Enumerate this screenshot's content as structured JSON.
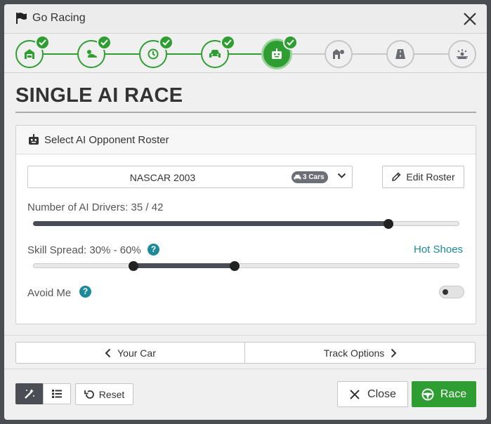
{
  "window": {
    "title": "Go Racing",
    "close_icon": "close-icon"
  },
  "steps": [
    {
      "name": "garage",
      "icon": "garage-icon",
      "state": "done"
    },
    {
      "name": "weather",
      "icon": "weather-icon",
      "state": "done"
    },
    {
      "name": "time",
      "icon": "clock-icon",
      "state": "done"
    },
    {
      "name": "car",
      "icon": "car-icon",
      "state": "done"
    },
    {
      "name": "ai-opponents",
      "icon": "robot-icon",
      "state": "active"
    },
    {
      "name": "pit-crew",
      "icon": "pit-icon",
      "state": "todo"
    },
    {
      "name": "track",
      "icon": "road-icon",
      "state": "todo"
    },
    {
      "name": "race-start",
      "icon": "start-light-icon",
      "state": "todo"
    }
  ],
  "page_title": "SINGLE AI RACE",
  "panel": {
    "header": "Select AI Opponent Roster",
    "roster_value": "NASCAR 2003",
    "cars_badge": "3 Cars",
    "edit_roster": "Edit Roster",
    "drivers_label": "Number of AI Drivers: 35 / 42",
    "drivers_value": 35,
    "drivers_max": 42,
    "skill_label": "Skill Spread: 30% - 60%",
    "skill_low": 30,
    "skill_high": 60,
    "hot_shoes": "Hot Shoes",
    "avoid_me": "Avoid Me",
    "avoid_me_on": false
  },
  "nav": {
    "prev": "Your Car",
    "next": "Track Options"
  },
  "footer": {
    "reset": "Reset",
    "close": "Close",
    "race": "Race"
  },
  "colors": {
    "accent": "#2f9e32",
    "link": "#1d8a99",
    "slider": "#4a4c55"
  }
}
